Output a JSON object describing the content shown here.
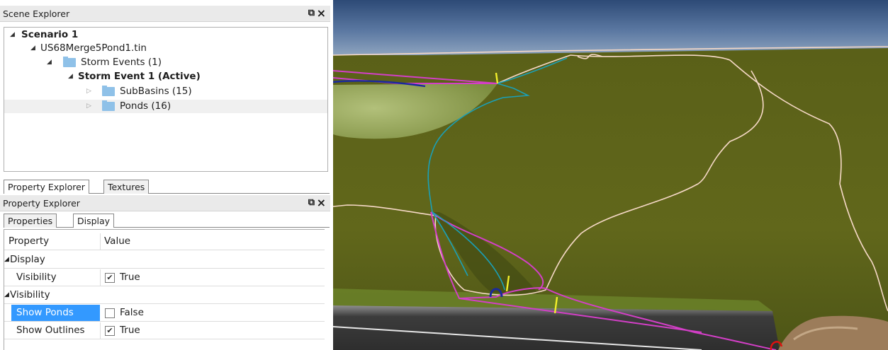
{
  "scene_explorer": {
    "title": "Scene Explorer",
    "pin_icon": "pin-icon",
    "close_icon": "close-icon",
    "tree": [
      {
        "label": "Scenario 1",
        "bold": true
      },
      {
        "label": "US68Merge5Pond1.tin",
        "bold": false
      },
      {
        "label": "Storm Events (1)",
        "bold": false
      },
      {
        "label": "Storm Event 1 (Active)",
        "bold": true
      },
      {
        "label": "SubBasins (15)",
        "bold": false
      },
      {
        "label": "Ponds (16)",
        "bold": false
      }
    ],
    "bottom_tabs": [
      "Property Explorer",
      "Textures"
    ]
  },
  "property_explorer": {
    "title": "Property Explorer",
    "tabs": [
      "Properties",
      "Display"
    ],
    "columns": [
      "Property",
      "Value"
    ],
    "categories": [
      "Display",
      "Visibility"
    ],
    "rows": [
      {
        "name": "Visibility",
        "checked": true,
        "value": "True"
      },
      {
        "name": "Show Ponds",
        "checked": false,
        "value": "False"
      },
      {
        "name": "Show Outlines",
        "checked": true,
        "value": "True"
      }
    ]
  },
  "viewport": {
    "description_icon": "terrain-3d-view",
    "colors": {
      "terrain": "#5f6419",
      "sky": "#3d5a86",
      "subbasin_outline": "#f6d9c7",
      "pond_outline": "#d33fc7",
      "flowpath": "#1aa0b8",
      "marker": "#f2ef2a"
    }
  }
}
